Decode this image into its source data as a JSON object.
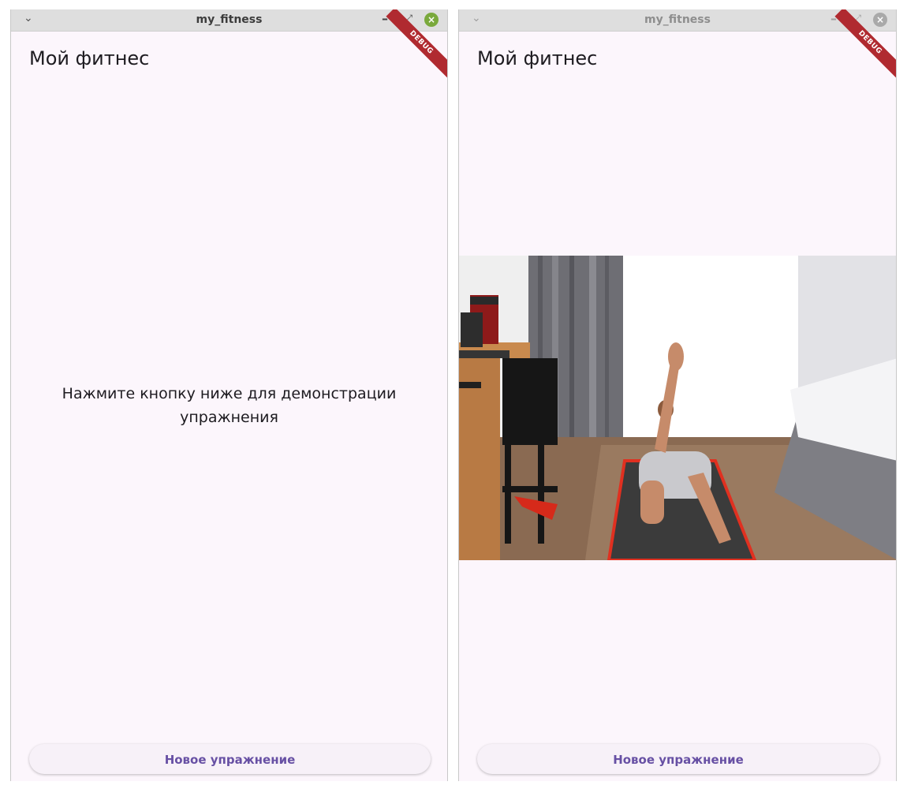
{
  "windows": [
    {
      "titlebar": {
        "title": "my_fitness",
        "menu_icon": "chevron-down-icon",
        "minimize_icon": "minimize-icon",
        "maximize_icon": "maximize-icon",
        "close_icon": "close-icon"
      },
      "app_title": "Мой фитнес",
      "debug_banner": "DEBUG",
      "center_text": "Нажмите кнопку ниже для демонстрации упражнения",
      "button_label": "Новое упражнение"
    },
    {
      "titlebar": {
        "title": "my_fitness",
        "menu_icon": "chevron-down-icon",
        "minimize_icon": "minimize-icon",
        "maximize_icon": "maximize-icon",
        "close_icon": "close-icon"
      },
      "app_title": "Мой фитнес",
      "debug_banner": "DEBUG",
      "media": "exercise-animation",
      "button_label": "Новое упражнение"
    }
  ],
  "colors": {
    "app_background": "#fcf6fc",
    "primary": "#6750a4",
    "debug_ribbon": "#b02a30",
    "active_close": "#7aa93c",
    "inactive_close": "#a9a9a9"
  }
}
